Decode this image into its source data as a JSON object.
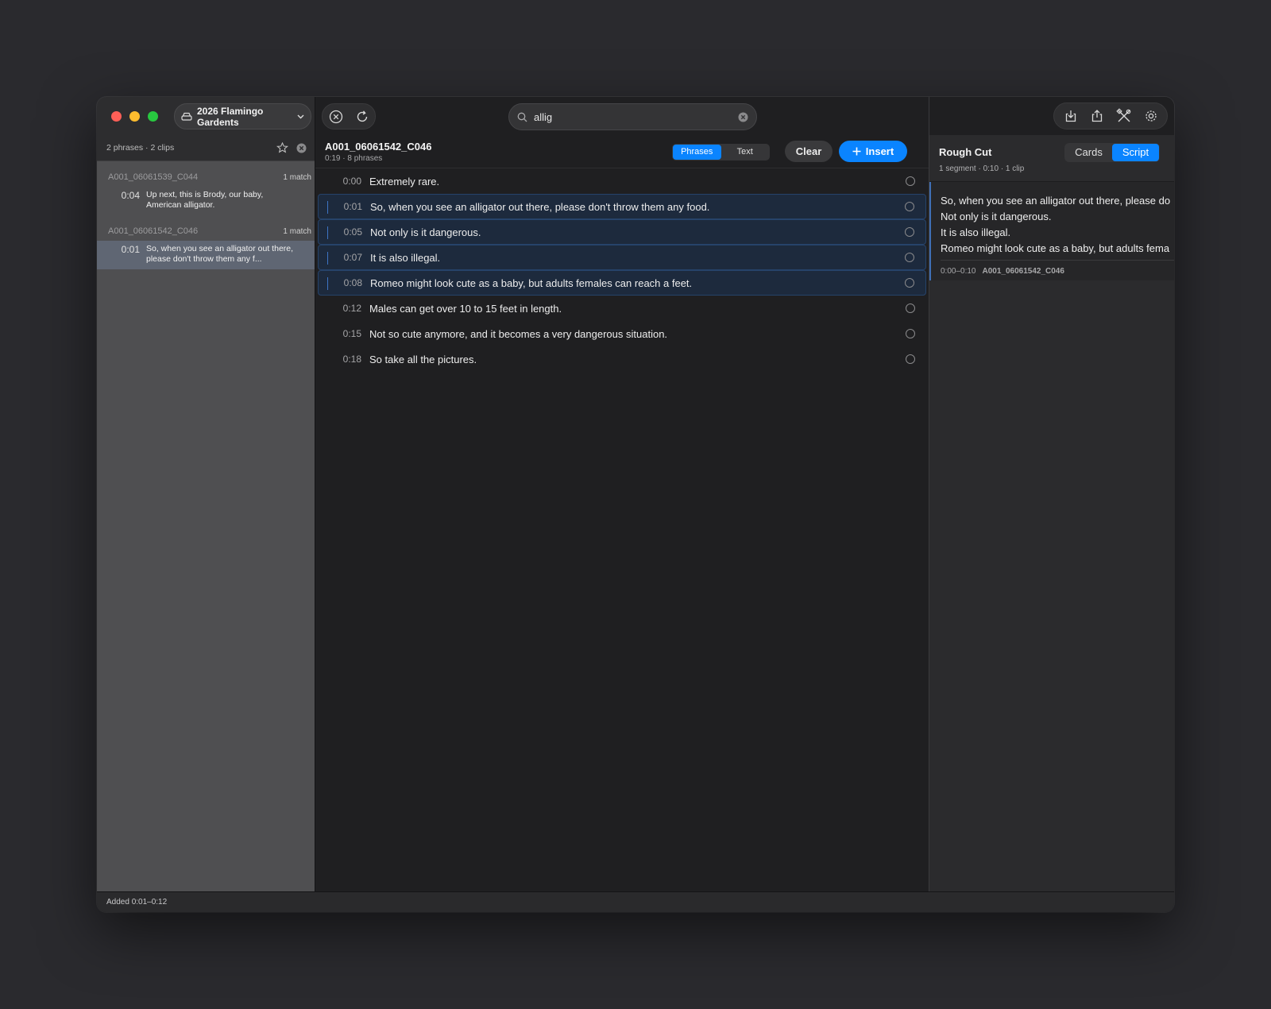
{
  "window": {
    "project_name": "2026 Flamingo Gardents",
    "search": {
      "value": "allig",
      "placeholder": "Search"
    }
  },
  "sidebar": {
    "summary": "2 phrases · 2 clips",
    "clips": [
      {
        "name": "A001_06061539_C044",
        "match": "1 match",
        "results": [
          {
            "time": "0:04",
            "text": "Up next, this is Brody, our baby, American alligator.",
            "selected": false
          }
        ]
      },
      {
        "name": "A001_06061542_C046",
        "match": "1 match",
        "results": [
          {
            "time": "0:01",
            "text": "So, when you see an alligator out there, please don't throw them any f...",
            "selected": true
          }
        ]
      }
    ]
  },
  "clip": {
    "title": "A001_06061542_C046",
    "meta": "0:19 · 8 phrases",
    "tabs": {
      "phrases": "Phrases",
      "text": "Text"
    },
    "clear_label": "Clear",
    "insert_label": "Insert",
    "phrases": [
      {
        "time": "0:00",
        "text": "Extremely rare.",
        "selected": false
      },
      {
        "time": "0:01",
        "text": "So, when you see an alligator out there, please don't throw them any food.",
        "selected": true
      },
      {
        "time": "0:05",
        "text": "Not only is it dangerous.",
        "selected": true
      },
      {
        "time": "0:07",
        "text": "It is also illegal.",
        "selected": true
      },
      {
        "time": "0:08",
        "text": "Romeo might look cute as a baby, but adults females can reach a feet.",
        "selected": true
      },
      {
        "time": "0:12",
        "text": "Males can get over 10 to 15 feet in length.",
        "selected": false
      },
      {
        "time": "0:15",
        "text": "Not so cute anymore, and it becomes a very dangerous situation.",
        "selected": false
      },
      {
        "time": "0:18",
        "text": "So take all the pictures.",
        "selected": false
      }
    ]
  },
  "rough_cut": {
    "title": "Rough Cut",
    "meta": "1 segment · 0:10 · 1 clip",
    "tabs": {
      "cards": "Cards",
      "script": "Script"
    },
    "script_lines": [
      "So, when you see an alligator out there, please do",
      "Not only is it dangerous.",
      "It is also illegal.",
      "Romeo might look cute as a baby, but adults fema"
    ],
    "segment_range": "0:00–0:10",
    "segment_clip": "A001_06061542_C046"
  },
  "status": {
    "text": "Added 0:01–0:12"
  },
  "colors": {
    "accent": "#0a84ff",
    "selection": "#1d2a3d",
    "sidebar_selected": "#5f6673"
  },
  "icons": [
    "drive-icon",
    "chevron-down-icon",
    "star-icon",
    "clear-circle-icon",
    "close-circle-icon",
    "refresh-icon",
    "search-icon",
    "plus-icon",
    "import-icon",
    "share-icon",
    "tools-icon",
    "gear-icon"
  ]
}
